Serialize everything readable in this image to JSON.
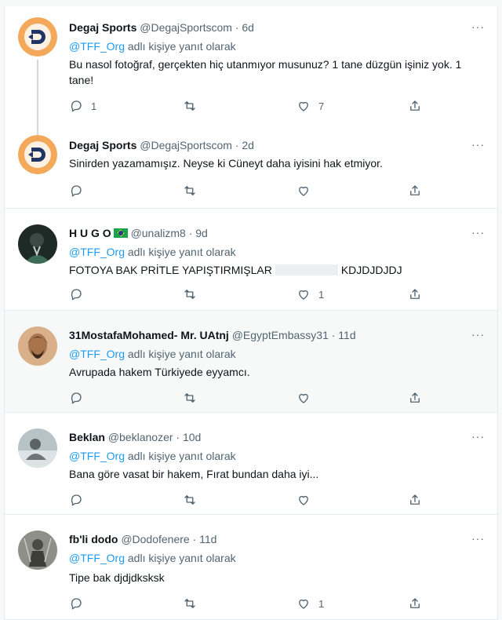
{
  "tweets": [
    {
      "name": "Degaj Sports",
      "handle": "@DegajSportscom",
      "time": "· 6d",
      "reply_handle": "@TFF_Org",
      "reply_suffix": " adlı kişiye yanıt olarak",
      "text": "Bu nasol fotoğraf, gerçekten hiç utanmıyor musunuz? 1 tane düzgün işiniz yok. 1 tane!",
      "reply_count": "1",
      "retweet_count": "",
      "like_count": "7"
    },
    {
      "name": "Degaj Sports",
      "handle": "@DegajSportscom",
      "time": "· 2d",
      "text": "Sinirden yazamamışız. Neyse ki Cüneyt daha iyisini hak etmiyor.",
      "reply_count": "",
      "retweet_count": "",
      "like_count": ""
    },
    {
      "name": "H U G O",
      "handle": "@unalizm8",
      "time": "· 9d",
      "reply_handle": "@TFF_Org",
      "reply_suffix": " adlı kişiye yanıt olarak",
      "text_before": "FOTOYA BAK PRİTLE YAPIŞTIRMIŞLAR",
      "text_after": "KDJDJDJDJ",
      "reply_count": "",
      "retweet_count": "",
      "like_count": "1"
    },
    {
      "name": "31MostafaMohamed- Mr. UAtnj",
      "handle": "@EgyptEmbassy31",
      "time": "· 11d",
      "reply_handle": "@TFF_Org",
      "reply_suffix": " adlı kişiye yanıt olarak",
      "text": "Avrupada hakem Türkiyede eyyamcı.",
      "reply_count": "",
      "retweet_count": "",
      "like_count": ""
    },
    {
      "name": "Beklan",
      "handle": "@beklanozer",
      "time": "· 10d",
      "reply_handle": "@TFF_Org",
      "reply_suffix": " adlı kişiye yanıt olarak",
      "text": "Bana göre vasat bir hakem, Fırat bundan daha iyi...",
      "reply_count": "",
      "retweet_count": "",
      "like_count": ""
    },
    {
      "name": "fb'li dodo",
      "handle": "@Dodofenere",
      "time": "· 11d",
      "reply_handle": "@TFF_Org",
      "reply_suffix": " adlı kişiye yanıt olarak",
      "text": "Tipe bak djdjdksksk",
      "reply_count": "",
      "retweet_count": "",
      "like_count": "1"
    }
  ],
  "more_label": "···",
  "icons": {
    "reply": "reply-icon",
    "retweet": "retweet-icon",
    "like": "heart-icon",
    "share": "share-icon",
    "more": "more-options-icon"
  },
  "colors": {
    "link": "#1d9bf0",
    "muted": "#536471",
    "degaj_orange": "#f3a85a",
    "degaj_navy": "#1f3566"
  }
}
